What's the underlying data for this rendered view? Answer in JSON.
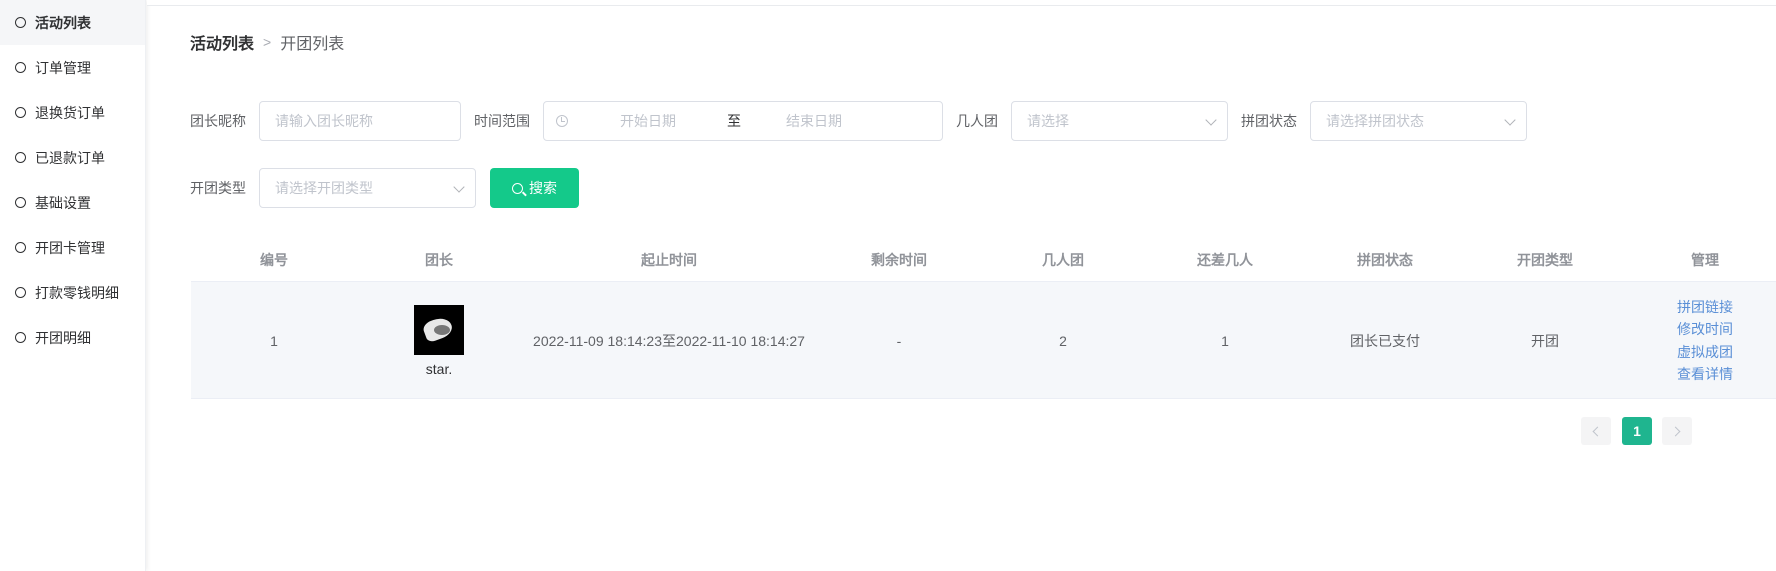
{
  "sidebar": {
    "items": [
      {
        "label": "活动列表",
        "active": true
      },
      {
        "label": "订单管理"
      },
      {
        "label": "退换货订单"
      },
      {
        "label": "已退款订单"
      },
      {
        "label": "基础设置"
      },
      {
        "label": "开团卡管理"
      },
      {
        "label": "打款零钱明细"
      },
      {
        "label": "开团明细"
      }
    ]
  },
  "breadcrumb": {
    "parent": "活动列表",
    "separator": ">",
    "current": "开团列表"
  },
  "filters": {
    "leader_name": {
      "label": "团长昵称",
      "placeholder": "请输入团长昵称"
    },
    "time_range": {
      "label": "时间范围",
      "start_placeholder": "开始日期",
      "separator": "至",
      "end_placeholder": "结束日期"
    },
    "group_size": {
      "label": "几人团",
      "placeholder": "请选择"
    },
    "group_status": {
      "label": "拼团状态",
      "placeholder": "请选择拼团状态"
    },
    "open_type": {
      "label": "开团类型",
      "placeholder": "请选择开团类型"
    },
    "search_button": "搜索"
  },
  "table": {
    "headers": [
      "编号",
      "团长",
      "起止时间",
      "剩余时间",
      "几人团",
      "还差几人",
      "拼团状态",
      "开团类型",
      "管理"
    ],
    "rows": [
      {
        "id": "1",
        "leader": "star.",
        "time": "2022-11-09 18:14:23至2022-11-10 18:14:27",
        "remaining": "-",
        "size": "2",
        "missing": "1",
        "status": "团长已支付",
        "type": "开团",
        "actions": [
          "拼团链接",
          "修改时间",
          "虚拟成团",
          "查看详情"
        ]
      }
    ]
  },
  "pagination": {
    "current": "1"
  },
  "colors": {
    "primary": "#14c98a",
    "page_active": "#1fb58f",
    "link": "#5a8fd6"
  }
}
